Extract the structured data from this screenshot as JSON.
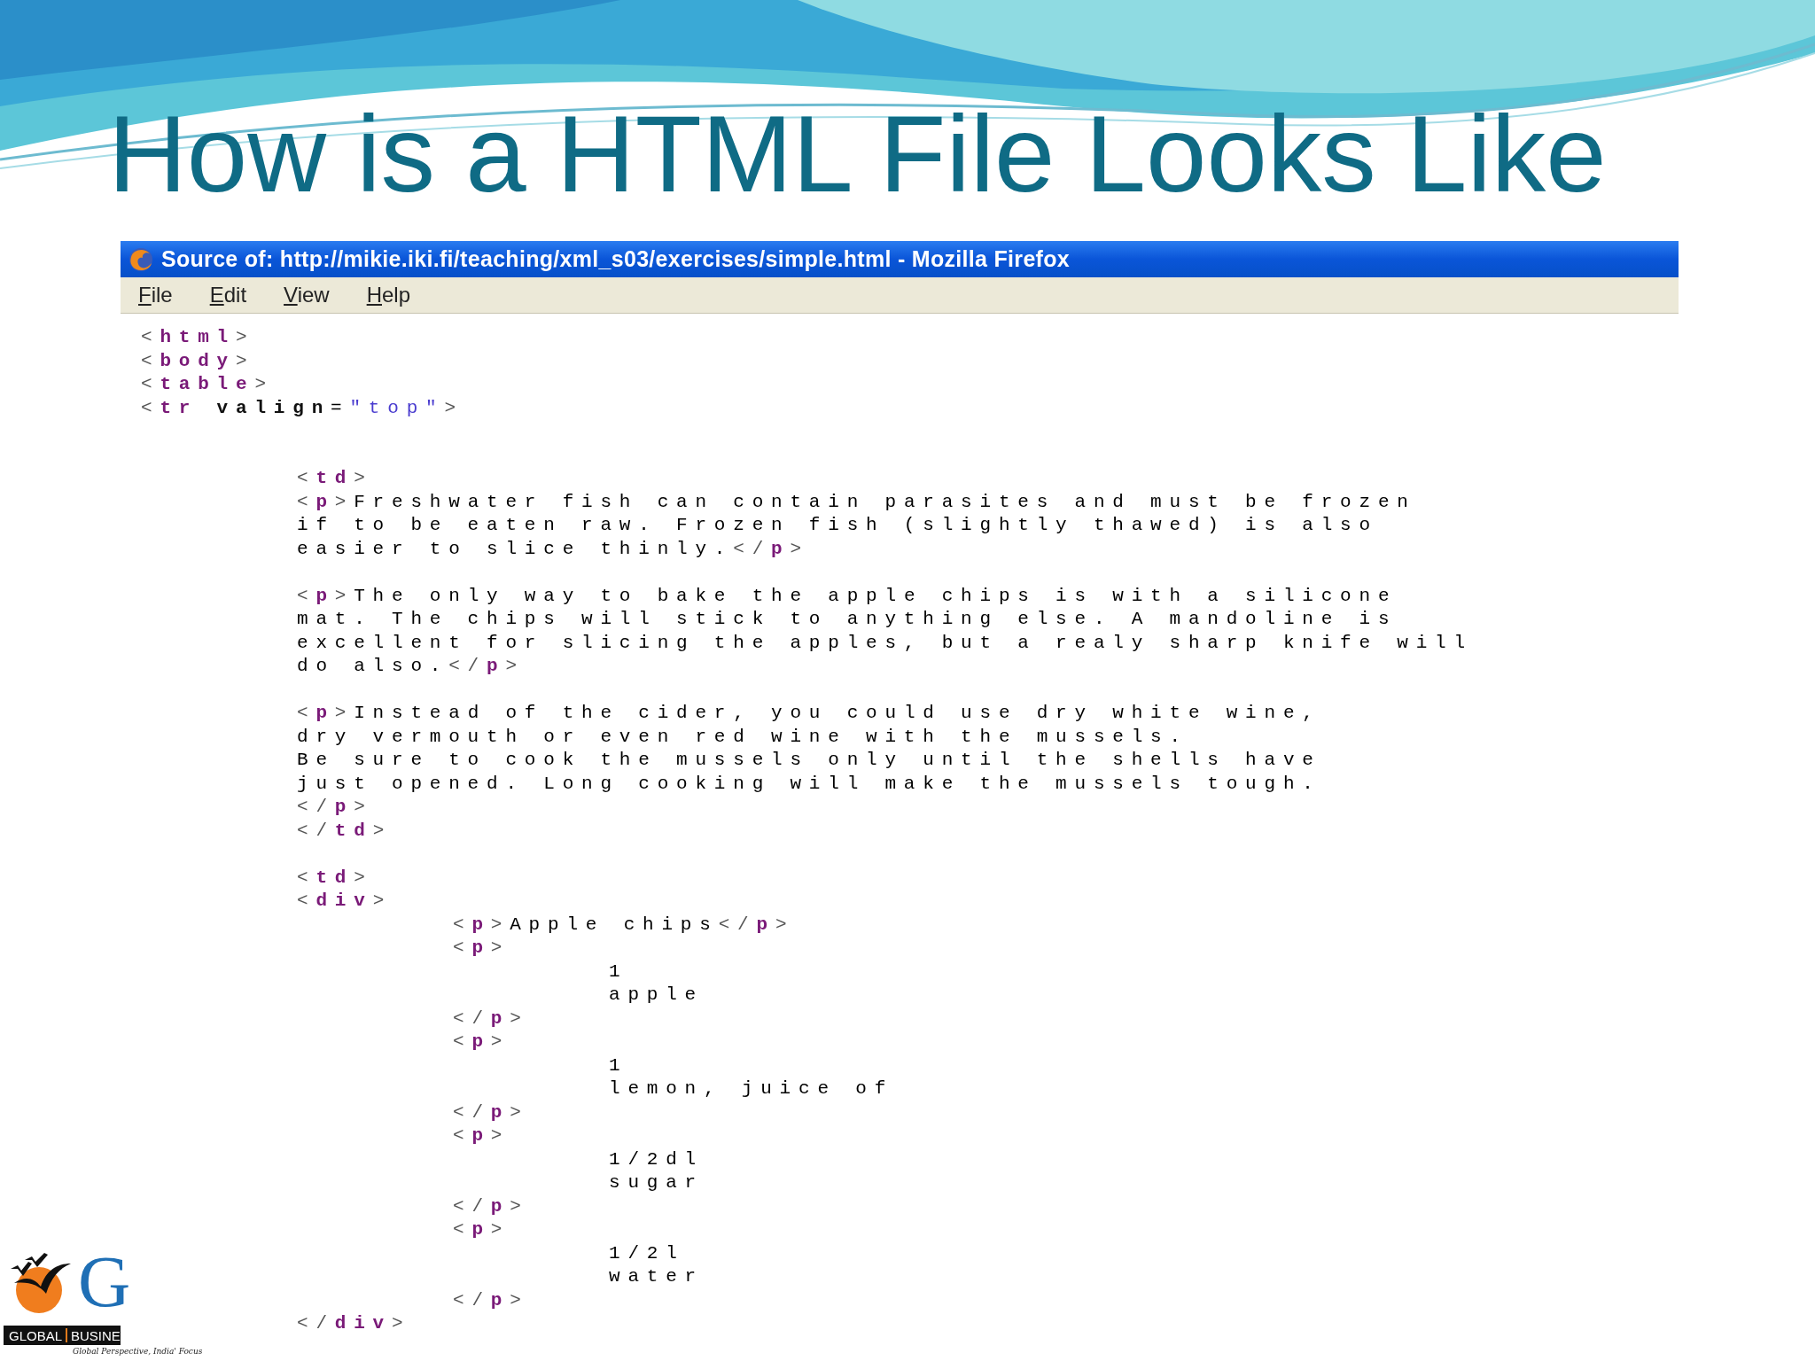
{
  "slide": {
    "title": "How is a HTML File Looks Like"
  },
  "window": {
    "title": "Source of: http://mikie.iki.fi/teaching/xml_s03/exercises/simple.html - Mozilla Firefox",
    "menu": [
      {
        "label": "File"
      },
      {
        "label": "Edit"
      },
      {
        "label": "View"
      },
      {
        "label": "Help"
      }
    ],
    "source_lines": [
      {
        "kind": "code",
        "tokens": [
          {
            "kind": "bracket",
            "text": "<"
          },
          {
            "kind": "tag",
            "text": "html"
          },
          {
            "kind": "bracket",
            "text": ">"
          }
        ]
      },
      {
        "kind": "code",
        "tokens": [
          {
            "kind": "bracket",
            "text": "<"
          },
          {
            "kind": "tag",
            "text": "body"
          },
          {
            "kind": "bracket",
            "text": ">"
          }
        ]
      },
      {
        "kind": "code",
        "tokens": [
          {
            "kind": "bracket",
            "text": "<"
          },
          {
            "kind": "tag",
            "text": "table"
          },
          {
            "kind": "bracket",
            "text": ">"
          }
        ]
      },
      {
        "kind": "code",
        "tokens": [
          {
            "kind": "bracket",
            "text": "<"
          },
          {
            "kind": "tag",
            "text": "tr"
          },
          {
            "kind": "attr",
            "text": " valign"
          },
          {
            "kind": "text",
            "text": "="
          },
          {
            "kind": "value",
            "text": "\"top\""
          },
          {
            "kind": "bracket",
            "text": ">"
          }
        ],
        "children": [
          {
            "kind": "blank"
          },
          {
            "kind": "blank"
          },
          {
            "kind": "code",
            "tokens": [
              {
                "kind": "bracket",
                "text": "<"
              },
              {
                "kind": "tag",
                "text": "td"
              },
              {
                "kind": "bracket",
                "text": ">"
              }
            ]
          },
          {
            "kind": "code",
            "tokens": [
              {
                "kind": "bracket",
                "text": "<"
              },
              {
                "kind": "tag",
                "text": "p"
              },
              {
                "kind": "bracket",
                "text": ">"
              },
              {
                "kind": "text",
                "text": "Freshwater fish can contain parasites and must be frozen"
              }
            ]
          },
          {
            "kind": "code",
            "tokens": [
              {
                "kind": "text",
                "text": "if to be eaten raw. Frozen fish (slightly thawed) is also"
              }
            ]
          },
          {
            "kind": "code",
            "tokens": [
              {
                "kind": "text",
                "text": "easier to slice thinly."
              },
              {
                "kind": "bracket",
                "text": "</"
              },
              {
                "kind": "tag",
                "text": "p"
              },
              {
                "kind": "bracket",
                "text": ">"
              }
            ]
          },
          {
            "kind": "blank"
          },
          {
            "kind": "code",
            "tokens": [
              {
                "kind": "bracket",
                "text": "<"
              },
              {
                "kind": "tag",
                "text": "p"
              },
              {
                "kind": "bracket",
                "text": ">"
              },
              {
                "kind": "text",
                "text": "The only way to bake the apple chips is with a silicone"
              }
            ]
          },
          {
            "kind": "code",
            "tokens": [
              {
                "kind": "text",
                "text": "mat. The chips will stick to anything else. A mandoline is"
              }
            ]
          },
          {
            "kind": "code",
            "tokens": [
              {
                "kind": "text",
                "text": "excellent for slicing the apples, but a realy sharp knife will"
              }
            ]
          },
          {
            "kind": "code",
            "tokens": [
              {
                "kind": "text",
                "text": "do also."
              },
              {
                "kind": "bracket",
                "text": "</"
              },
              {
                "kind": "tag",
                "text": "p"
              },
              {
                "kind": "bracket",
                "text": ">"
              }
            ]
          },
          {
            "kind": "blank"
          },
          {
            "kind": "code",
            "tokens": [
              {
                "kind": "bracket",
                "text": "<"
              },
              {
                "kind": "tag",
                "text": "p"
              },
              {
                "kind": "bracket",
                "text": ">"
              },
              {
                "kind": "text",
                "text": "Instead of the cider, you could use dry white wine,"
              }
            ]
          },
          {
            "kind": "code",
            "tokens": [
              {
                "kind": "text",
                "text": "dry vermouth or even red wine with the mussels."
              }
            ]
          },
          {
            "kind": "code",
            "tokens": [
              {
                "kind": "text",
                "text": "Be sure to cook the mussels only until the shells have"
              }
            ]
          },
          {
            "kind": "code",
            "tokens": [
              {
                "kind": "text",
                "text": "just opened. Long cooking will make the mussels tough."
              }
            ]
          },
          {
            "kind": "code",
            "tokens": [
              {
                "kind": "bracket",
                "text": "</"
              },
              {
                "kind": "tag",
                "text": "p"
              },
              {
                "kind": "bracket",
                "text": ">"
              }
            ]
          },
          {
            "kind": "code",
            "tokens": [
              {
                "kind": "bracket",
                "text": "</"
              },
              {
                "kind": "tag",
                "text": "td"
              },
              {
                "kind": "bracket",
                "text": ">"
              }
            ]
          },
          {
            "kind": "blank"
          },
          {
            "kind": "code",
            "tokens": [
              {
                "kind": "bracket",
                "text": "<"
              },
              {
                "kind": "tag",
                "text": "td"
              },
              {
                "kind": "bracket",
                "text": ">"
              }
            ]
          },
          {
            "kind": "code",
            "tokens": [
              {
                "kind": "bracket",
                "text": "<"
              },
              {
                "kind": "tag",
                "text": "div"
              },
              {
                "kind": "bracket",
                "text": ">"
              }
            ],
            "children": [
              {
                "kind": "code",
                "tokens": [
                  {
                    "kind": "bracket",
                    "text": "<"
                  },
                  {
                    "kind": "tag",
                    "text": "p"
                  },
                  {
                    "kind": "bracket",
                    "text": ">"
                  },
                  {
                    "kind": "text",
                    "text": "Apple chips"
                  },
                  {
                    "kind": "bracket",
                    "text": "</"
                  },
                  {
                    "kind": "tag",
                    "text": "p"
                  },
                  {
                    "kind": "bracket",
                    "text": ">"
                  }
                ]
              },
              {
                "kind": "code",
                "tokens": [
                  {
                    "kind": "bracket",
                    "text": "<"
                  },
                  {
                    "kind": "tag",
                    "text": "p"
                  },
                  {
                    "kind": "bracket",
                    "text": ">"
                  }
                ],
                "children": [
                  {
                    "kind": "code",
                    "tokens": [
                      {
                        "kind": "text",
                        "text": "1"
                      }
                    ]
                  },
                  {
                    "kind": "code",
                    "tokens": [
                      {
                        "kind": "text",
                        "text": "apple"
                      }
                    ]
                  }
                ]
              },
              {
                "kind": "code",
                "tokens": [
                  {
                    "kind": "bracket",
                    "text": "</"
                  },
                  {
                    "kind": "tag",
                    "text": "p"
                  },
                  {
                    "kind": "bracket",
                    "text": ">"
                  }
                ]
              },
              {
                "kind": "code",
                "tokens": [
                  {
                    "kind": "bracket",
                    "text": "<"
                  },
                  {
                    "kind": "tag",
                    "text": "p"
                  },
                  {
                    "kind": "bracket",
                    "text": ">"
                  }
                ],
                "children": [
                  {
                    "kind": "code",
                    "tokens": [
                      {
                        "kind": "text",
                        "text": "1"
                      }
                    ]
                  },
                  {
                    "kind": "code",
                    "tokens": [
                      {
                        "kind": "text",
                        "text": "lemon, juice of"
                      }
                    ]
                  }
                ]
              },
              {
                "kind": "code",
                "tokens": [
                  {
                    "kind": "bracket",
                    "text": "</"
                  },
                  {
                    "kind": "tag",
                    "text": "p"
                  },
                  {
                    "kind": "bracket",
                    "text": ">"
                  }
                ]
              },
              {
                "kind": "code",
                "tokens": [
                  {
                    "kind": "bracket",
                    "text": "<"
                  },
                  {
                    "kind": "tag",
                    "text": "p"
                  },
                  {
                    "kind": "bracket",
                    "text": ">"
                  }
                ],
                "children": [
                  {
                    "kind": "code",
                    "tokens": [
                      {
                        "kind": "text",
                        "text": "1/2dl"
                      }
                    ]
                  },
                  {
                    "kind": "code",
                    "tokens": [
                      {
                        "kind": "text",
                        "text": "sugar"
                      }
                    ]
                  }
                ]
              },
              {
                "kind": "code",
                "tokens": [
                  {
                    "kind": "bracket",
                    "text": "</"
                  },
                  {
                    "kind": "tag",
                    "text": "p"
                  },
                  {
                    "kind": "bracket",
                    "text": ">"
                  }
                ]
              },
              {
                "kind": "code",
                "tokens": [
                  {
                    "kind": "bracket",
                    "text": "<"
                  },
                  {
                    "kind": "tag",
                    "text": "p"
                  },
                  {
                    "kind": "bracket",
                    "text": ">"
                  }
                ],
                "children": [
                  {
                    "kind": "code",
                    "tokens": [
                      {
                        "kind": "text",
                        "text": "1/2l"
                      }
                    ]
                  },
                  {
                    "kind": "code",
                    "tokens": [
                      {
                        "kind": "text",
                        "text": "water"
                      }
                    ]
                  }
                ]
              },
              {
                "kind": "code",
                "tokens": [
                  {
                    "kind": "bracket",
                    "text": "</"
                  },
                  {
                    "kind": "tag",
                    "text": "p"
                  },
                  {
                    "kind": "bracket",
                    "text": ">"
                  }
                ]
              }
            ]
          },
          {
            "kind": "code",
            "tokens": [
              {
                "kind": "bracket",
                "text": "</"
              },
              {
                "kind": "tag",
                "text": "div"
              },
              {
                "kind": "bracket",
                "text": ">"
              }
            ]
          }
        ]
      }
    ]
  },
  "logo": {
    "letter": "G",
    "name_left": "GLOBAL",
    "name_right": "BUSINE",
    "tagline": "Global Perspective, India' Focus"
  }
}
